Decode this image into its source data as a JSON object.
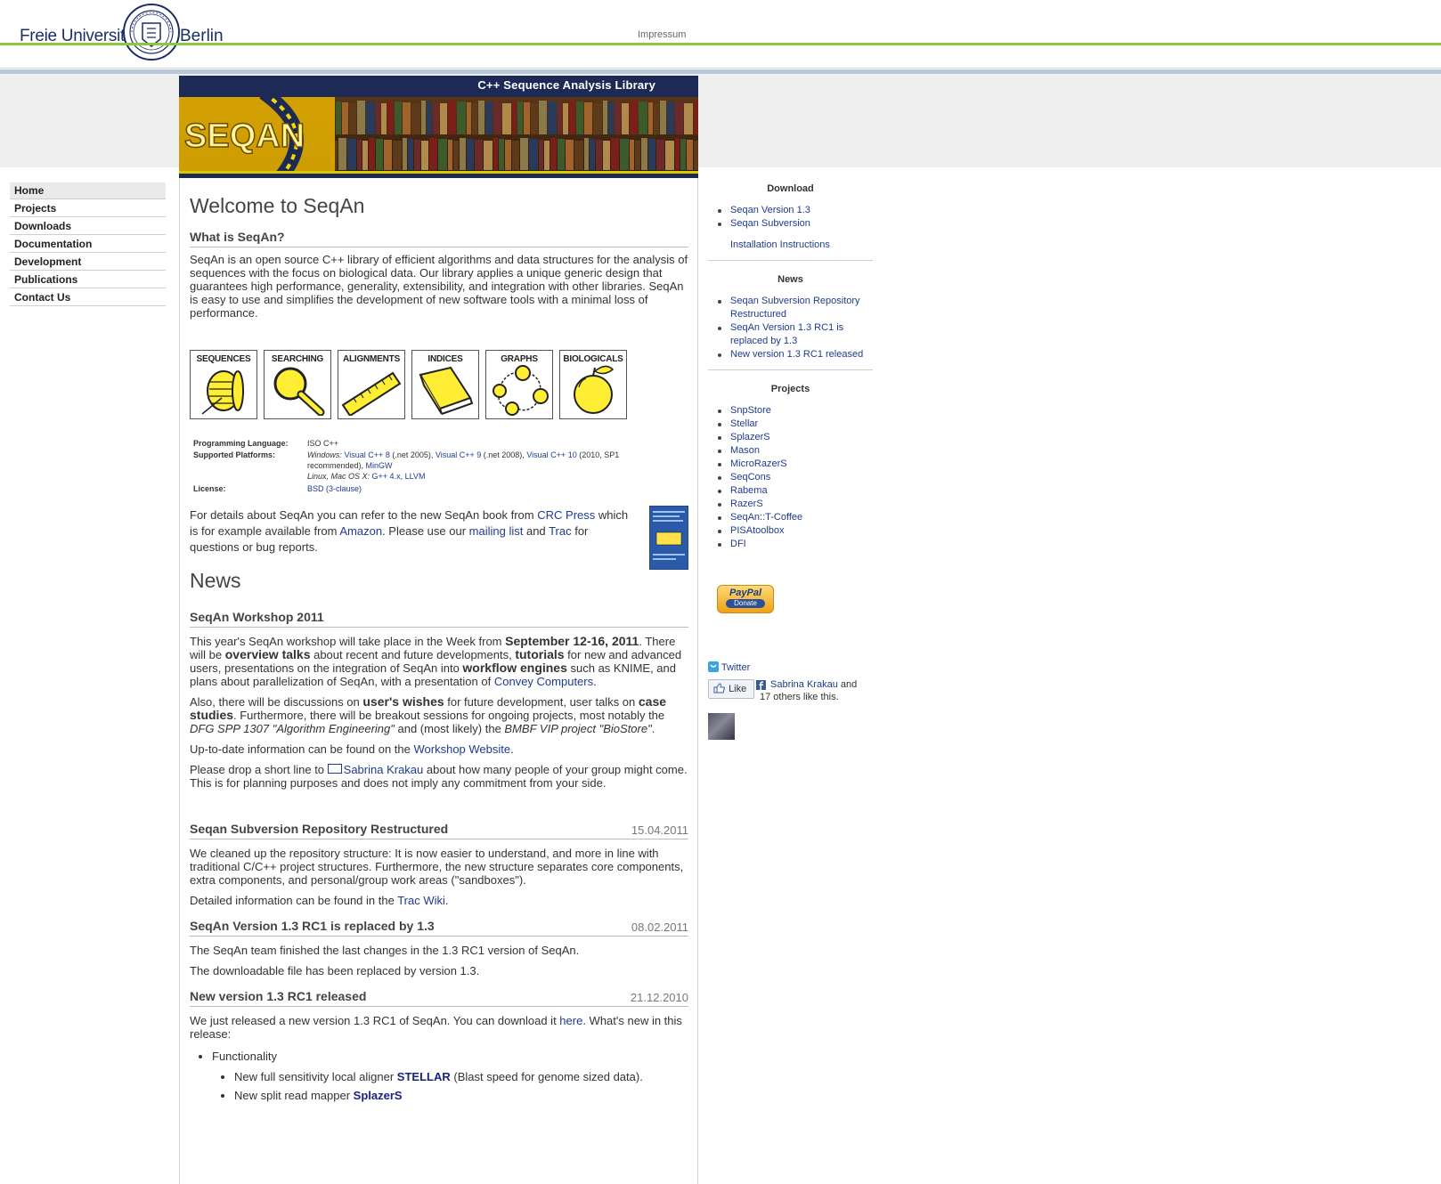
{
  "header": {
    "logo_left": "Freie Universität",
    "logo_right": "Berlin",
    "impressum": "Impressum"
  },
  "banner": {
    "title": "C++ Sequence Analysis Library",
    "logo_text": "SEQAN"
  },
  "nav": {
    "items": [
      "Home",
      "Projects",
      "Downloads",
      "Documentation",
      "Development",
      "Publications",
      "Contact Us"
    ]
  },
  "welcome": {
    "title": "Welcome to SeqAn",
    "what_heading": "What is SeqAn?",
    "intro": "SeqAn is an open source C++ library of efficient algorithms and data structures for the analysis of sequences with the focus on biological data. Our library applies a unique generic design that guarantees high performance, generality, extensibility, and integration with other libraries. SeqAn is easy to use and simplifies the development of new software tools with a minimal loss of performance.",
    "icons": [
      "SEQUENCES",
      "SEARCHING",
      "ALIGNMENTS",
      "INDICES",
      "GRAPHS",
      "BIOLOGICALS"
    ],
    "facts": {
      "lang_label": "Programming Language:",
      "lang_value": "ISO C++",
      "platforms_label": "Supported Platforms:",
      "win_label": "Windows:",
      "vc8": "Visual C++ 8",
      "vc8_note": "(.net 2005),",
      "vc9": "Visual C++ 9",
      "vc9_note": "(.net 2008),",
      "vc10": "Visual C++ 10",
      "vc10_note": "(2010, SP1 recommended),",
      "mingw": "MinGW",
      "unix_label": "Linux, Mac OS X:",
      "gcc": "G++ 4.x",
      "llvm": "LLVM",
      "license_label": "License:",
      "license_value": "BSD (3-clause)"
    },
    "book": {
      "t1": "For details about SeqAn you can refer to the new SeqAn book from",
      "crc": "CRC Press",
      "t2": "which is for example available from",
      "amazon": "Amazon",
      "t3": ". Please use our",
      "mailing": "mailing list",
      "t4": "and",
      "trac": "Trac",
      "t5": "for questions or bug reports."
    }
  },
  "news": {
    "title": "News",
    "workshop": {
      "heading": "SeqAn Workshop 2011",
      "p1": [
        "This year's SeqAn workshop will take place in the Week from ",
        "September 12-16, 2011",
        ". There will be ",
        "overview talks",
        " about recent and future developments, ",
        "tutorials",
        " for new and advanced users, presentations on the integration of SeqAn into ",
        "workflow engines",
        " such as KNIME, and plans about parallelization of SeqAn, with a presentation of ",
        "Convey Computers",
        "."
      ],
      "p2": [
        "Also, there will be discussions on ",
        "user's wishes",
        " for future development, user talks on ",
        "case studies",
        ". Furthermore, there will be breakout sessions for ongoing projects, most notably the ",
        "DFG SPP 1307 \"Algorithm Engineering\"",
        " and (most likely) the ",
        "BMBF VIP project \"BioStore\"",
        "."
      ],
      "p3a": "Up-to-date information can be found on the ",
      "p3link": "Workshop Website",
      "p3b": ".",
      "p4a": "Please drop a short line to ",
      "p4link": "Sabrina Krakau",
      "p4b": " about how many people of your group might come. This is for planning purposes and does not imply any commitment from your side."
    },
    "svn": {
      "heading": "Seqan Subversion Repository Restructured",
      "date": "15.04.2011",
      "p1": "We cleaned up the repository structure: It is now easier to understand, and more in line with traditional C/C++ project structures. Furthermore, the new structure separates core components, extra components, and personal/group work areas (\"sandboxes\").",
      "p2a": "Detailed information can be found in the ",
      "p2link": "Trac Wiki",
      "p2b": "."
    },
    "rc_replaced": {
      "heading": "SeqAn Version 1.3 RC1 is replaced by 1.3",
      "date": "08.02.2011",
      "p1": "The SeqAn team finished the last changes in the 1.3 RC1 version of SeqAn.",
      "p2": "The downloadable file has been replaced by version 1.3."
    },
    "rc_released": {
      "heading": "New version 1.3 RC1 released",
      "date": "21.12.2010",
      "p1a": "We just released a new version 1.3 RC1 of SeqAn. You can download it ",
      "p1link": "here",
      "p1b": ". What's new in this release:",
      "func": "Functionality",
      "item1a": "New full sensitivity local aligner ",
      "item1b": "STELLAR",
      "item1c": " (Blast speed for genome sized data).",
      "item2a": "New split read mapper ",
      "item2b": "SplazerS"
    }
  },
  "sidebar": {
    "download_heading": "Download",
    "download_links": [
      "Seqan Version 1.3",
      "Seqan Subversion"
    ],
    "install": "Installation Instructions",
    "news_heading": "News",
    "news_links": [
      "Seqan Subversion Repository Restructured",
      "SeqAn Version 1.3 RC1 is replaced by 1.3",
      "New version 1.3 RC1 released"
    ],
    "projects_heading": "Projects",
    "projects": [
      "SnpStore",
      "Stellar",
      "SplazerS",
      "Mason",
      "MicroRazerS",
      "SeqCons",
      "Rabema",
      "RazerS",
      "SeqAn::T-Coffee",
      "PISAtoolbox",
      "DFI"
    ],
    "paypal": "PayPal",
    "paypal_sub": "Donate",
    "twitter": "Twitter",
    "like": "Like",
    "fb_name": "Sabrina Krakau",
    "fb_rest": " and 17 others like this."
  },
  "colors": {
    "link": "#1f3b8e",
    "green_bar": "#8dc63f",
    "banner_bg": "#1c2a55",
    "icon_yellow": "#ffee33"
  }
}
